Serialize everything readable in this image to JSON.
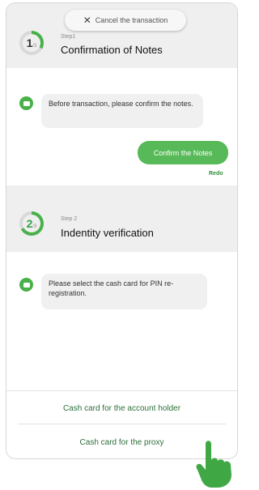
{
  "header": {
    "cancel_label": "Cancel the transaction"
  },
  "steps": [
    {
      "kicker": "Step1",
      "number": "1",
      "denominator": "/3",
      "title": "Confirmation of Notes",
      "progress": 0.33
    },
    {
      "kicker": "Step 2",
      "number": "2",
      "denominator": "/3",
      "title": "Indentity verification",
      "progress": 0.67
    }
  ],
  "chat": {
    "bot_message_1": "Before transaction, please confirm the notes.",
    "user_reply": "Confirm the Notes",
    "redo_label": "Redo",
    "bot_message_2": "Please select the cash card for PIN re-registration."
  },
  "options": [
    {
      "label": "Cash card for the account holder"
    },
    {
      "label": "Cash card for the proxy"
    }
  ],
  "colors": {
    "accent": "#49b04a",
    "step_band": "#efefef",
    "ring_track": "#d9d9d9"
  },
  "icons": {
    "cancel": "close-icon",
    "bot": "bot-icon",
    "pointer": "hand-pointer-icon"
  }
}
